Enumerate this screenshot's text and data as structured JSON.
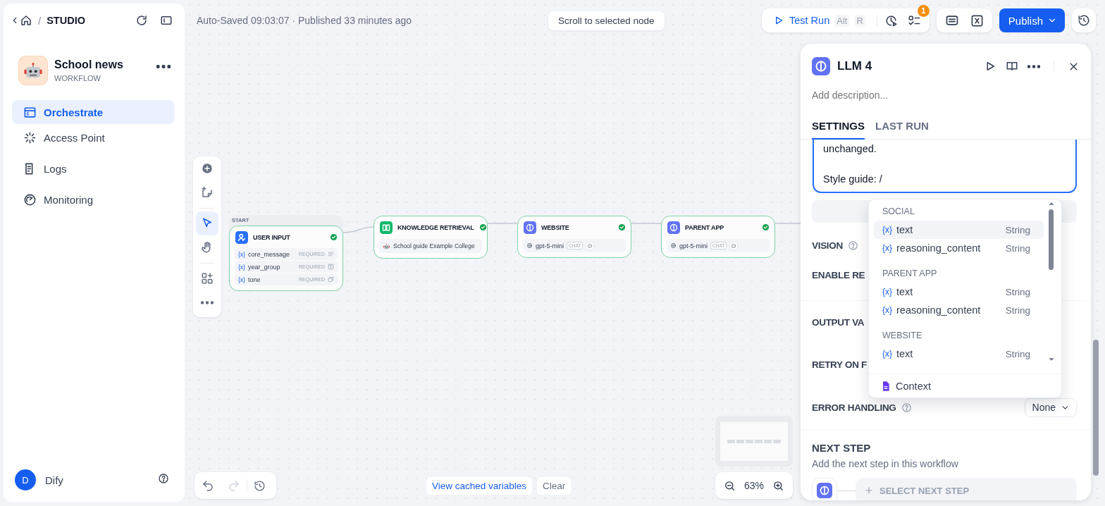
{
  "breadcrumb": {
    "separator": "/",
    "section": "STUDIO"
  },
  "app": {
    "name": "School news",
    "type": "WORKFLOW"
  },
  "nav": [
    {
      "kind": "orchestrate",
      "label": "Orchestrate",
      "selected": true
    },
    {
      "kind": "access",
      "label": "Access Point",
      "selected": false
    },
    {
      "kind": "logs",
      "label": "Logs",
      "selected": false
    },
    {
      "kind": "monitoring",
      "label": "Monitoring",
      "selected": false
    }
  ],
  "user": {
    "initial": "D",
    "name": "Dify"
  },
  "status_text": "Auto-Saved 09:03:07 · Published 33 minutes ago",
  "scroll_hint": "Scroll to selected node",
  "toolbar": {
    "test_run": "Test Run",
    "shortcut": [
      "Alt",
      "R"
    ],
    "badge": "1",
    "publish": "Publish"
  },
  "canvas_tools": [
    {
      "kind": "add",
      "selected": false
    },
    {
      "kind": "note",
      "selected": false
    },
    {
      "kind": "pointer",
      "selected": true
    },
    {
      "kind": "hand",
      "selected": false
    },
    {
      "kind": "layout",
      "selected": false
    },
    {
      "kind": "more",
      "selected": false
    }
  ],
  "nodes": [
    {
      "kind": "start",
      "tag": "START",
      "title": "USER INPUT",
      "succeeded": true,
      "variables": [
        {
          "icon": "{x}",
          "name": "core_message",
          "badge": "REQUIRED",
          "kind": "paragraph"
        },
        {
          "icon": "{x}",
          "name": "year_group",
          "badge": "REQUIRED",
          "kind": "text"
        },
        {
          "icon": "{x}",
          "name": "tone",
          "badge": "REQUIRED",
          "kind": "select"
        }
      ]
    },
    {
      "kind": "knowledge",
      "title": "KNOWLEDGE RETRIEVAL",
      "succeeded": true,
      "dataset": "School guide Example College"
    },
    {
      "kind": "llm",
      "title": "WEBSITE",
      "succeeded": true,
      "model": "gpt-5-mini",
      "mode": "CHAT"
    },
    {
      "kind": "llm",
      "title": "PARENT APP",
      "succeeded": true,
      "model": "gpt-5-mini",
      "mode": "CHAT"
    }
  ],
  "history_controls": [
    {
      "kind": "undo",
      "disabled": false
    },
    {
      "kind": "redo",
      "disabled": true
    }
  ],
  "cache": {
    "link": "View cached variables",
    "clear": "Clear"
  },
  "zoom": "63%",
  "panel": {
    "title": "LLM 4",
    "description_placeholder": "Add description...",
    "tabs": [
      {
        "label": "SETTINGS",
        "selected": true
      },
      {
        "label": "LAST RUN",
        "selected": false
      }
    ],
    "prompt_text": "unchanged.\n\nStyle guide: /",
    "settings": [
      {
        "label": "VISION",
        "help": true
      },
      {
        "label": "ENABLE RE",
        "help": false
      },
      {
        "label": "OUTPUT VA",
        "help": false
      },
      {
        "label": "RETRY ON F",
        "help": false
      },
      {
        "label": "ERROR HANDLING",
        "help": true,
        "value": "None"
      }
    ],
    "next_step": {
      "title": "NEXT STEP",
      "hint": "Add the next step in this workflow",
      "button": "SELECT NEXT STEP"
    }
  },
  "dropdown": {
    "groups": [
      {
        "title": "SOCIAL",
        "items": [
          {
            "icon": "{x}",
            "name": "text",
            "type": "String",
            "selected": true
          },
          {
            "icon": "{x}",
            "name": "reasoning_content",
            "type": "String",
            "selected": false
          }
        ]
      },
      {
        "title": "PARENT APP",
        "items": [
          {
            "icon": "{x}",
            "name": "text",
            "type": "String",
            "selected": false
          },
          {
            "icon": "{x}",
            "name": "reasoning_content",
            "type": "String",
            "selected": false
          }
        ]
      },
      {
        "title": "WEBSITE",
        "items": [
          {
            "icon": "{x}",
            "name": "text",
            "type": "String",
            "selected": false
          }
        ]
      }
    ],
    "footer": "Context"
  }
}
